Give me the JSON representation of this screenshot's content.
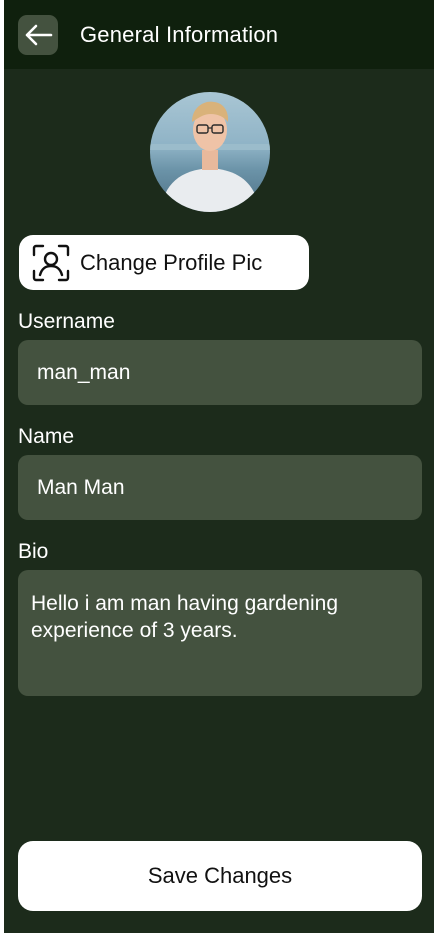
{
  "header": {
    "title": "General Information",
    "back_icon": "arrow-left-icon"
  },
  "profile": {
    "avatar_description": "profile-photo",
    "change_pic_label": "Change Profile Pic",
    "change_pic_icon": "face-scan-icon"
  },
  "form": {
    "username": {
      "label": "Username",
      "value": "man_man"
    },
    "name": {
      "label": "Name",
      "value": "Man Man"
    },
    "bio": {
      "label": "Bio",
      "value": "Hello i am man having gardening experience of 3 years."
    }
  },
  "actions": {
    "save_label": "Save Changes"
  },
  "colors": {
    "background": "#1c2b1b",
    "header": "#0f200d",
    "field": "#44523f",
    "button": "#ffffff"
  }
}
